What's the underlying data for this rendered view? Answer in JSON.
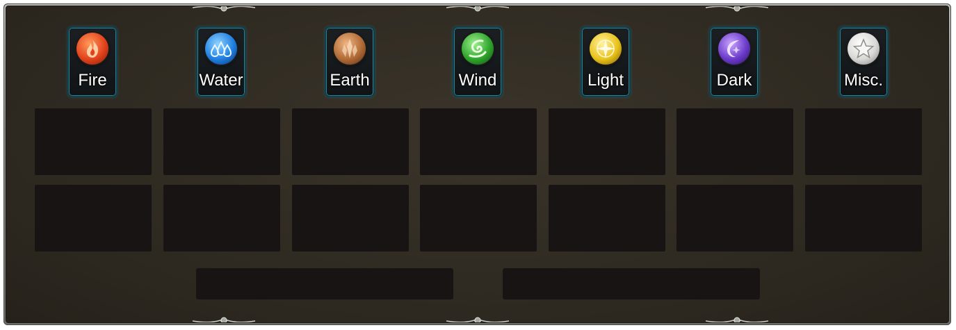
{
  "elements": [
    {
      "label": "Fire",
      "icon": "fire-icon",
      "color": "#e2431c"
    },
    {
      "label": "Water",
      "icon": "water-icon",
      "color": "#1f7fe0"
    },
    {
      "label": "Earth",
      "icon": "earth-icon",
      "color": "#b06a36"
    },
    {
      "label": "Wind",
      "icon": "wind-icon",
      "color": "#2fa52c"
    },
    {
      "label": "Light",
      "icon": "light-icon",
      "color": "#e9c21b"
    },
    {
      "label": "Dark",
      "icon": "dark-icon",
      "color": "#6b3bc9"
    },
    {
      "label": "Misc.",
      "icon": "star-icon",
      "color": "#d8d8d6"
    }
  ],
  "theme": {
    "panel_bg": "#302b22",
    "slot_bg": "#181413",
    "button_border": "#2f7f8f",
    "frame": "#9a9a94"
  }
}
